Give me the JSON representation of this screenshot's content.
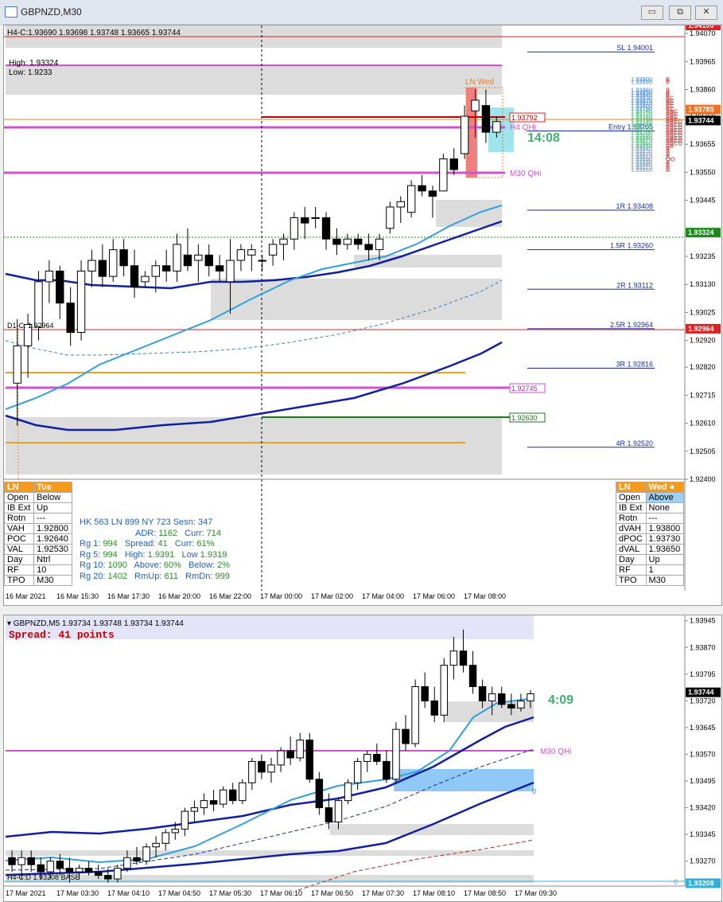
{
  "window": {
    "title": "GBPNZD,M30",
    "btn_min": "▭",
    "btn_restore": "⧉",
    "btn_close": "✕"
  },
  "top_chart": {
    "header": "H4-C:1.93690  1.93698 1.93748 1.93665 1.93744",
    "high": "High: 1.93324",
    "low": "Low: 1.9233",
    "d1c": "D1-C: 1.92964",
    "ln_wed": "LN Wed",
    "h4_qhi": "H4 QHi",
    "m30_qhi": "M30 QHi",
    "timer": "14:08",
    "box_193792": "1.93792",
    "box_192745": "1.92745",
    "box_192630": "1.92630",
    "pivots": [
      {
        "label": "SL 1.94001",
        "price": 1.94001
      },
      {
        "label": "Entry 1.93705",
        "price": 1.93705
      },
      {
        "label": "1R 1.93408",
        "price": 1.93408
      },
      {
        "label": "1.5R 1.93260",
        "price": 1.9326
      },
      {
        "label": "2R 1.93112",
        "price": 1.93112
      },
      {
        "label": "2.5R 1.92964",
        "price": 1.92964
      },
      {
        "label": "3R 1.92816",
        "price": 1.92816
      },
      {
        "label": "4R 1.92520",
        "price": 1.9252
      }
    ],
    "ladder": [
      "1.93900",
      "1.93890",
      "1.93860",
      "1.93850",
      "1.93840",
      "1.93830",
      "1.93820",
      "1.93810",
      "1.93800",
      "1.93790",
      "1.93780",
      "1.93770",
      "1.93760",
      "1.93750",
      "1.93740",
      "1.93730",
      "1.93720",
      "1.93710",
      "1.93700",
      "1.93690",
      "1.93680",
      "1.93670",
      "1.93660",
      "1.93650",
      "1.93640",
      "1.93630",
      "1.93620",
      "1.93610",
      "1.93600",
      "1.93590",
      "1.93580",
      "1.93570",
      "1.93560"
    ],
    "ladder_letters": [
      "B",
      "B",
      "B",
      "B",
      "B",
      "BC",
      "BC",
      "BC",
      "BC",
      "BC",
      "ABC",
      "ABC",
      "ABC",
      "ABC",
      "ABCD",
      "ABCD",
      "ABCD",
      "ABCD",
      "ABCD",
      "ABCD",
      "ABCD",
      "ABCD",
      "ABCD",
      "AB",
      "A",
      "A",
      "A",
      "A",
      "OO",
      "A",
      "A",
      "A",
      "A"
    ],
    "yaxis": [
      "1.94070",
      "1.93965",
      "1.93860",
      "1.93760",
      "1.93655",
      "1.93550",
      "1.93445",
      "1.93235",
      "1.93130",
      "1.93025",
      "1.92920",
      "1.92820",
      "1.92715",
      "1.92610",
      "1.92505",
      "1.92400"
    ],
    "price_tags": [
      {
        "label": "1.94100",
        "price": 1.941,
        "bg": "#e02020"
      },
      {
        "label": "1.93785",
        "price": 1.93785,
        "bg": "#f07020"
      },
      {
        "label": "1.93744",
        "price": 1.93744,
        "bg": "#000000"
      },
      {
        "label": "1.93324",
        "price": 1.93324,
        "bg": "#1a8a1a"
      },
      {
        "label": "1.92964",
        "price": 1.92964,
        "bg": "#e02020"
      }
    ],
    "xaxis": [
      "16 Mar 2021",
      "16 Mar 15:30",
      "16 Mar 17:30",
      "16 Mar 20:00",
      "16 Mar 22:00",
      "17 Mar 00:00",
      "17 Mar 02:00",
      "17 Mar 04:00",
      "17 Mar 06:00",
      "17 Mar 08:00"
    ],
    "ymin": 1.924,
    "ymax": 1.941,
    "candles": [
      [
        1.9276,
        1.93,
        1.926,
        1.929
      ],
      [
        1.929,
        1.9302,
        1.9278,
        1.9298
      ],
      [
        1.9297,
        1.9318,
        1.9292,
        1.9314
      ],
      [
        1.9314,
        1.9322,
        1.9306,
        1.9318
      ],
      [
        1.9318,
        1.932,
        1.93,
        1.9306
      ],
      [
        1.9306,
        1.9312,
        1.929,
        1.9295
      ],
      [
        1.9295,
        1.9322,
        1.9292,
        1.9318
      ],
      [
        1.9318,
        1.9326,
        1.9312,
        1.9322
      ],
      [
        1.9322,
        1.9328,
        1.9312,
        1.9316
      ],
      [
        1.9316,
        1.933,
        1.9314,
        1.9326
      ],
      [
        1.9326,
        1.933,
        1.9316,
        1.932
      ],
      [
        1.932,
        1.9326,
        1.9308,
        1.9312
      ],
      [
        1.9314,
        1.9318,
        1.9312,
        1.9316
      ],
      [
        1.9316,
        1.9322,
        1.931,
        1.932
      ],
      [
        1.932,
        1.9326,
        1.9314,
        1.9318
      ],
      [
        1.9318,
        1.9332,
        1.9314,
        1.9328
      ],
      [
        1.9324,
        1.9334,
        1.9318,
        1.932
      ],
      [
        1.9322,
        1.9328,
        1.9314,
        1.9324
      ],
      [
        1.9324,
        1.9328,
        1.9316,
        1.932
      ],
      [
        1.932,
        1.9324,
        1.9314,
        1.9318
      ],
      [
        1.9314,
        1.933,
        1.9302,
        1.9322
      ],
      [
        1.9322,
        1.9328,
        1.9318,
        1.9326
      ],
      [
        1.9324,
        1.9328,
        1.9318,
        1.9326
      ],
      [
        1.9322,
        1.9324,
        1.9318,
        1.9322
      ],
      [
        1.9324,
        1.933,
        1.932,
        1.9328
      ],
      [
        1.9328,
        1.9332,
        1.9322,
        1.933
      ],
      [
        1.933,
        1.934,
        1.9326,
        1.9338
      ],
      [
        1.9338,
        1.9342,
        1.933,
        1.9336
      ],
      [
        1.9338,
        1.9342,
        1.9334,
        1.9338
      ],
      [
        1.9338,
        1.934,
        1.9326,
        1.933
      ],
      [
        1.933,
        1.9334,
        1.9324,
        1.9328
      ],
      [
        1.9328,
        1.9332,
        1.9326,
        1.933
      ],
      [
        1.933,
        1.9332,
        1.9326,
        1.9328
      ],
      [
        1.9328,
        1.9332,
        1.9322,
        1.9326
      ],
      [
        1.9326,
        1.9332,
        1.9322,
        1.933
      ],
      [
        1.9334,
        1.9344,
        1.9332,
        1.9342
      ],
      [
        1.9342,
        1.9346,
        1.9336,
        1.9344
      ],
      [
        1.934,
        1.9352,
        1.9338,
        1.935
      ],
      [
        1.935,
        1.9354,
        1.9346,
        1.9348
      ],
      [
        1.9348,
        1.935,
        1.9338,
        1.9346
      ],
      [
        1.9348,
        1.9362,
        1.9348,
        1.936
      ],
      [
        1.936,
        1.9364,
        1.9354,
        1.9356
      ],
      [
        1.9362,
        1.938,
        1.936,
        1.9376
      ],
      [
        1.9378,
        1.9386,
        1.9368,
        1.9382
      ],
      [
        1.938,
        1.9386,
        1.9366,
        1.937
      ],
      [
        1.937,
        1.9376,
        1.9368,
        1.9374
      ]
    ]
  },
  "left_table": {
    "header": [
      "LN",
      "Tue"
    ],
    "rows": [
      [
        "Open",
        "Below"
      ],
      [
        "IB Ext",
        "Up"
      ],
      [
        "Rotn",
        "---"
      ],
      [
        "VAH",
        "1.92800"
      ],
      [
        "POC",
        "1.92640"
      ],
      [
        "VAL",
        "1.92530"
      ],
      [
        "Day",
        "Ntrl"
      ],
      [
        "RF",
        "10"
      ],
      [
        "TPO",
        "M30"
      ]
    ]
  },
  "right_table": {
    "header": [
      "LN",
      "Wed ●"
    ],
    "rows": [
      [
        "Open",
        "Above"
      ],
      [
        "IB Ext",
        "None"
      ],
      [
        "Rotn",
        "---"
      ],
      [
        "dVAH",
        "1.93800"
      ],
      [
        "dPOC",
        "1.93730"
      ],
      [
        "dVAL",
        "1.93650"
      ],
      [
        "Day",
        "Up"
      ],
      [
        "RF",
        "1"
      ],
      [
        "TPO",
        "M30"
      ]
    ]
  },
  "stats": {
    "line1": "HK 563   LN  899  NY 723   Sesn: 347",
    "adr_l": "ADR:",
    "adr_v": "1162",
    "curr_l": "Curr:",
    "curr_v": "714",
    "rg1_l": "Rg  1:",
    "rg1_v": "994",
    "spread_l": "Spread:",
    "spread_v": "41",
    "curr2_l": "Curr:",
    "curr2_v": "61%",
    "rg5_l": "Rg  5:",
    "rg5_v": "994",
    "high_l": "High:",
    "high_v": "1.9391",
    "low_l": "Low",
    "low_v": "1.9319",
    "rg10_l": "Rg 10:",
    "rg10_v": "1090",
    "above_l": "Above:",
    "above_v": "60%",
    "below_l": "Below:",
    "below_v": "2%",
    "rg20_l": "Rg 20:",
    "rg20_v": "1402",
    "rmup_l": "RmUp:",
    "rmup_v": "611",
    "rmdn_l": "RmDn:",
    "rmdn_v": "999"
  },
  "bottom_chart": {
    "header": "▾ GBPNZD,M5  1.93734 1.93748 1.93734 1.93744",
    "spread": "Spread: 41 points",
    "timer": "4:09",
    "m30_qhi": "M30 QHi",
    "h4c": "H4-C:D  1.93208 BASE",
    "zero1": "0",
    "zero2": "0",
    "yaxis": [
      "1.93945",
      "1.93870",
      "1.93795",
      "1.93720",
      "1.93645",
      "1.93570",
      "1.93495",
      "1.93420",
      "1.93345",
      "1.93270"
    ],
    "price_tags": [
      {
        "label": "1.93744",
        "price": 1.93744,
        "bg": "#000000"
      },
      {
        "label": "1.93208",
        "price": 1.93208,
        "bg": "#30b0d8"
      }
    ],
    "xaxis": [
      "17 Mar 2021",
      "17 Mar 03:30",
      "17 Mar 04:10",
      "17 Mar 04:50",
      "17 Mar 05:30",
      "17 Mar 06:10",
      "17 Mar 06:50",
      "17 Mar 07:30",
      "17 Mar 08:10",
      "17 Mar 08:50",
      "17 Mar 09:30"
    ],
    "ymin": 1.932,
    "ymax": 1.9396,
    "candles": [
      [
        1.9328,
        1.933,
        1.9324,
        1.9326
      ],
      [
        1.9326,
        1.933,
        1.9322,
        1.9328
      ],
      [
        1.9328,
        1.933,
        1.9324,
        1.9326
      ],
      [
        1.9326,
        1.9328,
        1.9322,
        1.9324
      ],
      [
        1.9324,
        1.9328,
        1.9322,
        1.9327
      ],
      [
        1.9327,
        1.9329,
        1.9323,
        1.9325
      ],
      [
        1.9325,
        1.9328,
        1.9321,
        1.9324
      ],
      [
        1.9324,
        1.9326,
        1.9322,
        1.9325
      ],
      [
        1.9325,
        1.9327,
        1.9323,
        1.9324
      ],
      [
        1.9324,
        1.9326,
        1.9322,
        1.9323
      ],
      [
        1.9323,
        1.9325,
        1.9321,
        1.9322
      ],
      [
        1.9322,
        1.9326,
        1.9321,
        1.9325
      ],
      [
        1.9325,
        1.933,
        1.9324,
        1.9328
      ],
      [
        1.9328,
        1.9331,
        1.9326,
        1.9327
      ],
      [
        1.9327,
        1.9332,
        1.9326,
        1.9331
      ],
      [
        1.9331,
        1.9334,
        1.9328,
        1.9332
      ],
      [
        1.9332,
        1.9336,
        1.933,
        1.9335
      ],
      [
        1.9335,
        1.9338,
        1.9333,
        1.9336
      ],
      [
        1.9336,
        1.9342,
        1.9334,
        1.9341
      ],
      [
        1.9341,
        1.9344,
        1.9338,
        1.9342
      ],
      [
        1.9342,
        1.9346,
        1.934,
        1.9344
      ],
      [
        1.9344,
        1.9347,
        1.9341,
        1.9343
      ],
      [
        1.9343,
        1.9348,
        1.9342,
        1.9347
      ],
      [
        1.9347,
        1.9349,
        1.9343,
        1.9344
      ],
      [
        1.9344,
        1.935,
        1.9343,
        1.9349
      ],
      [
        1.9349,
        1.9356,
        1.9347,
        1.9355
      ],
      [
        1.9355,
        1.9357,
        1.935,
        1.9352
      ],
      [
        1.9352,
        1.9356,
        1.9349,
        1.9354
      ],
      [
        1.9354,
        1.9359,
        1.9352,
        1.9358
      ],
      [
        1.9358,
        1.9362,
        1.9354,
        1.9356
      ],
      [
        1.9356,
        1.9363,
        1.9355,
        1.9361
      ],
      [
        1.9361,
        1.9363,
        1.9349,
        1.935
      ],
      [
        1.935,
        1.9352,
        1.934,
        1.9342
      ],
      [
        1.9342,
        1.9346,
        1.9336,
        1.9338
      ],
      [
        1.9338,
        1.9345,
        1.9336,
        1.9344
      ],
      [
        1.9344,
        1.935,
        1.9343,
        1.9349
      ],
      [
        1.9349,
        1.9356,
        1.9347,
        1.9355
      ],
      [
        1.9355,
        1.9358,
        1.9352,
        1.9357
      ],
      [
        1.9357,
        1.936,
        1.9354,
        1.9355
      ],
      [
        1.9355,
        1.9358,
        1.9349,
        1.935
      ],
      [
        1.935,
        1.9366,
        1.9349,
        1.9364
      ],
      [
        1.9364,
        1.9368,
        1.9358,
        1.936
      ],
      [
        1.936,
        1.9378,
        1.9359,
        1.9376
      ],
      [
        1.9376,
        1.938,
        1.937,
        1.9372
      ],
      [
        1.9372,
        1.9376,
        1.9366,
        1.9368
      ],
      [
        1.9368,
        1.9384,
        1.9366,
        1.9382
      ],
      [
        1.9382,
        1.939,
        1.9378,
        1.9386
      ],
      [
        1.9386,
        1.9392,
        1.938,
        1.9382
      ],
      [
        1.9382,
        1.9386,
        1.9374,
        1.9376
      ],
      [
        1.9376,
        1.9378,
        1.937,
        1.9372
      ],
      [
        1.9372,
        1.9376,
        1.9368,
        1.9374
      ],
      [
        1.9374,
        1.9376,
        1.937,
        1.9371
      ],
      [
        1.9371,
        1.9374,
        1.9368,
        1.937
      ],
      [
        1.937,
        1.9374,
        1.9369,
        1.9372
      ],
      [
        1.9372,
        1.9375,
        1.937,
        1.9374
      ]
    ]
  }
}
